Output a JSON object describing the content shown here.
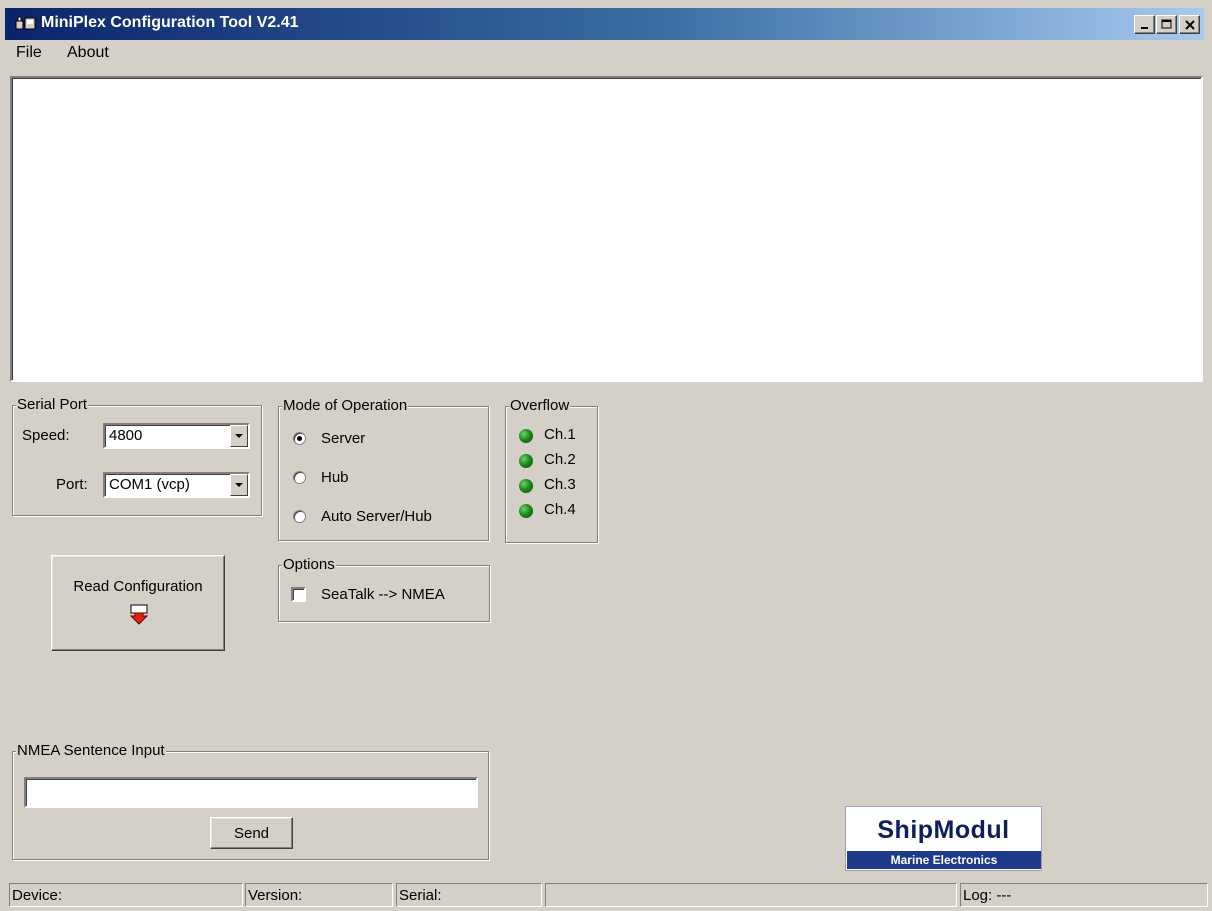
{
  "window": {
    "title": "MiniPlex Configuration Tool V2.41",
    "controls": [
      "minimize",
      "maximize",
      "close"
    ]
  },
  "menu": {
    "file": "File",
    "about": "About"
  },
  "serial_port": {
    "legend": "Serial Port",
    "speed_label": "Speed:",
    "speed_value": "4800",
    "port_label": "Port:",
    "port_value": "COM1 (vcp)"
  },
  "mode": {
    "legend": "Mode of Operation",
    "options": [
      "Server",
      "Hub",
      "Auto Server/Hub"
    ],
    "selected": "Server"
  },
  "overflow": {
    "legend": "Overflow",
    "channels": [
      "Ch.1",
      "Ch.2",
      "Ch.3",
      "Ch.4"
    ],
    "led_color": "#1e8a1e"
  },
  "read_config": {
    "label": "Read Configuration",
    "icon": "download-arrow-icon"
  },
  "options": {
    "legend": "Options",
    "seatalk_label": "SeaTalk --> NMEA",
    "seatalk_checked": false
  },
  "nmea": {
    "legend": "NMEA Sentence Input",
    "value": "",
    "send_label": "Send"
  },
  "logo": {
    "main": "ShipModul",
    "sub": "Marine Electronics"
  },
  "status": {
    "device": "Device:",
    "version": "Version:",
    "serial": "Serial:",
    "message": "",
    "log": "Log: ---"
  }
}
